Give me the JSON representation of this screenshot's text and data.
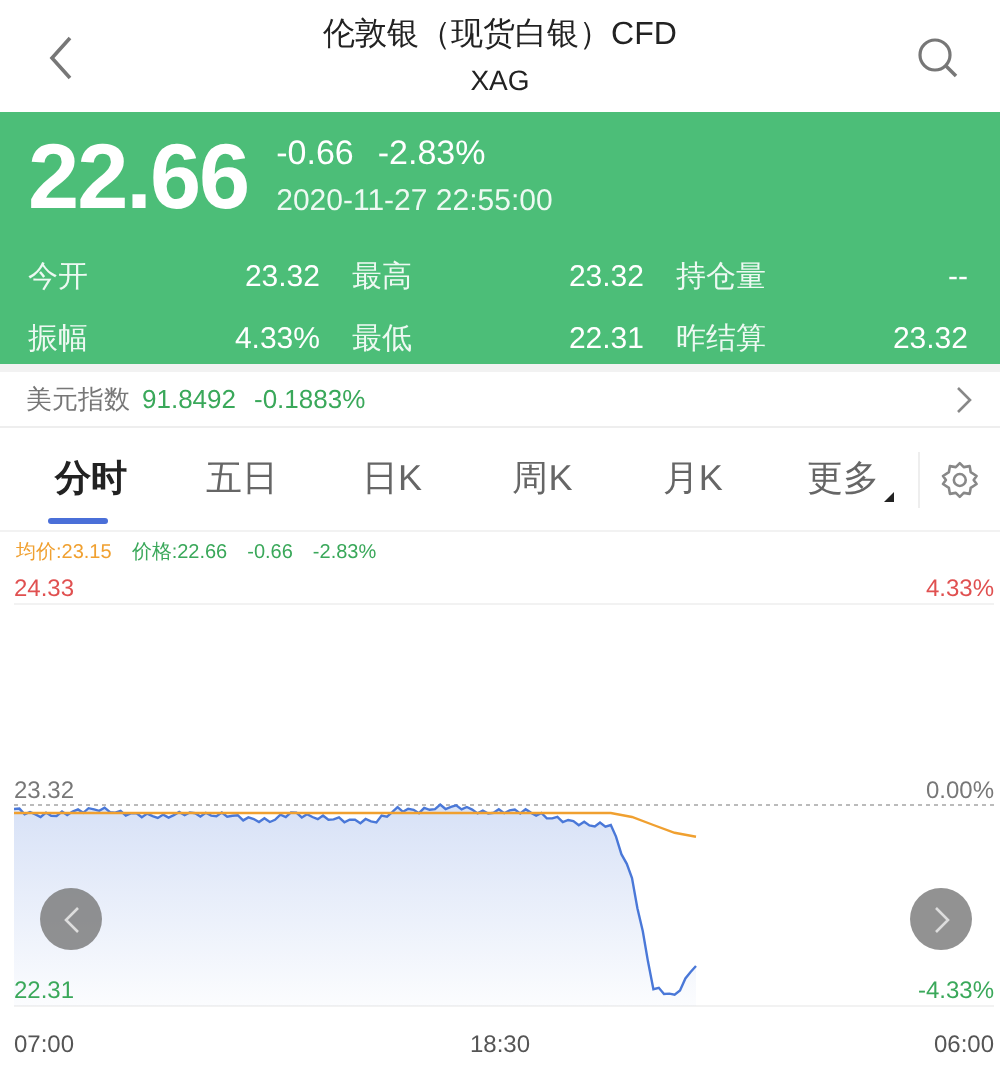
{
  "header": {
    "title": "伦敦银（现货白银）CFD",
    "subtitle": "XAG"
  },
  "quote": {
    "price": "22.66",
    "change": "-0.66",
    "change_pct": "-2.83%",
    "timestamp": "2020-11-27 22:55:00",
    "stats": [
      {
        "label": "今开",
        "value": "23.32"
      },
      {
        "label": "最高",
        "value": "23.32"
      },
      {
        "label": "持仓量",
        "value": "--"
      },
      {
        "label": "振幅",
        "value": "4.33%"
      },
      {
        "label": "最低",
        "value": "22.31"
      },
      {
        "label": "昨结算",
        "value": "23.32"
      }
    ]
  },
  "index_bar": {
    "label": "美元指数",
    "value": "91.8492",
    "change": "-0.1883%"
  },
  "tabs": [
    {
      "label": "分时",
      "selected": true,
      "kind": "plain"
    },
    {
      "label": "五日",
      "selected": false,
      "kind": "plain"
    },
    {
      "label": "日K",
      "selected": false,
      "kind": "plain"
    },
    {
      "label": "周K",
      "selected": false,
      "kind": "plain"
    },
    {
      "label": "月K",
      "selected": false,
      "kind": "plain"
    },
    {
      "label": "更多",
      "selected": false,
      "kind": "dropdown"
    }
  ],
  "chart": {
    "legend": [
      {
        "text": "均价:23.15",
        "color": "#f0a030"
      },
      {
        "text": "价格:22.66",
        "color": "#3aa85a"
      },
      {
        "text": "-0.66",
        "color": "#3aa85a"
      },
      {
        "text": "-2.83%",
        "color": "#3aa85a"
      }
    ],
    "left_labels": [
      {
        "text": "24.33",
        "color": "#e05050"
      },
      {
        "text": "23.32",
        "color": "#777777"
      },
      {
        "text": "22.31",
        "color": "#3aa85a"
      }
    ],
    "time_labels": [
      "07:00",
      "18:30",
      "06:00"
    ],
    "right_labels": [
      {
        "text": "4.33%",
        "color": "#e05050"
      },
      {
        "text": "0.00%",
        "color": "#777777"
      },
      {
        "text": "-4.33%",
        "color": "#3aa85a"
      }
    ],
    "kind": "picture"
  }
}
